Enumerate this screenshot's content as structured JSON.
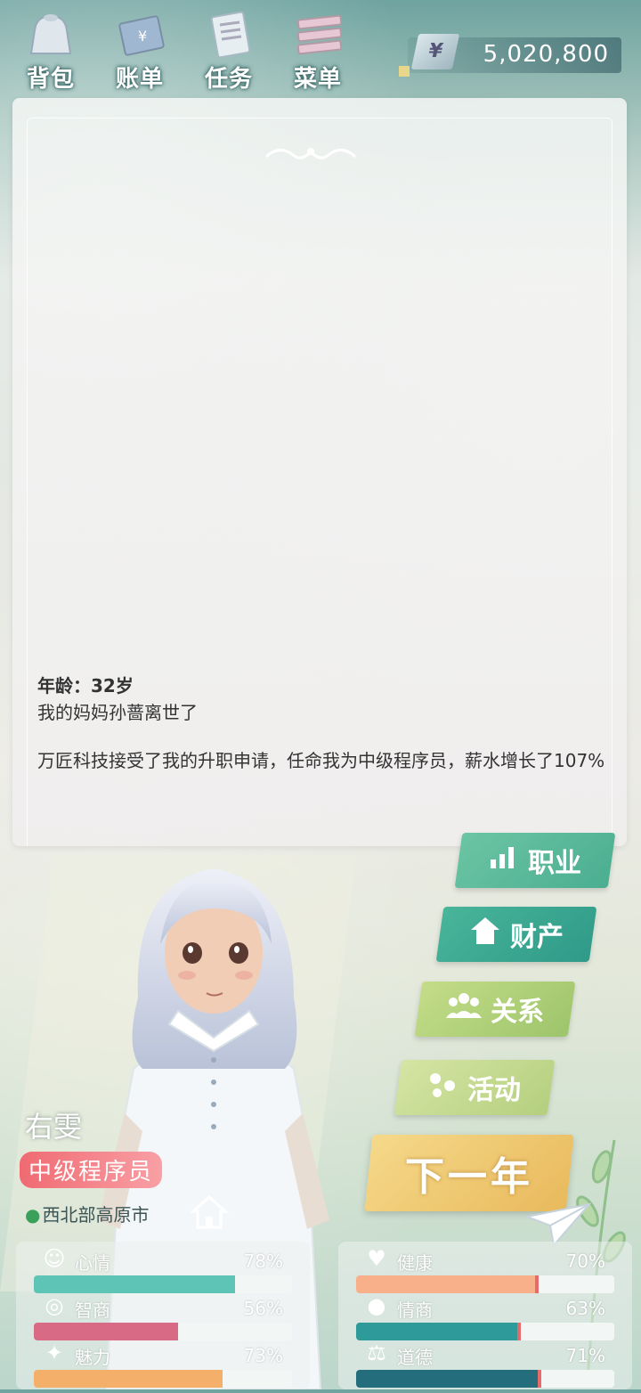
{
  "topbar": {
    "buttons": [
      {
        "label": "背包",
        "icon": "bag-icon"
      },
      {
        "label": "账单",
        "icon": "bill-icon"
      },
      {
        "label": "任务",
        "icon": "task-icon"
      },
      {
        "label": "菜单",
        "icon": "menu-icon"
      }
    ],
    "money": {
      "currency": "¥",
      "value": "5,020,800"
    }
  },
  "story": {
    "age_line": "年龄：32岁",
    "event1": "我的妈妈孙蔷离世了",
    "event2": "万匠科技接受了我的升职申请，任命我为中级程序员，薪水增长了107%"
  },
  "character": {
    "name": "右雯",
    "job": "中级程序员",
    "city": "西北部高原市"
  },
  "actions": {
    "career": "职业",
    "property": "财产",
    "relationship": "关系",
    "activity": "活动",
    "next_year": "下一年"
  },
  "stats": {
    "left": [
      {
        "name": "心情",
        "pct": "78%",
        "value": 78,
        "color": "#5ec4b6",
        "icon": "smile-icon"
      },
      {
        "name": "智商",
        "pct": "56%",
        "value": 56,
        "color": "#d86a86",
        "icon": "bulb-icon"
      },
      {
        "name": "魅力",
        "pct": "73%",
        "value": 73,
        "color": "#f4b06b",
        "icon": "sparkle-icon"
      }
    ],
    "right": [
      {
        "name": "健康",
        "pct": "70%",
        "value": 70,
        "color": "#f7b08a",
        "icon": "heart-icon"
      },
      {
        "name": "情商",
        "pct": "63%",
        "value": 63,
        "color": "#2e9a9a",
        "icon": "apple-icon"
      },
      {
        "name": "道德",
        "pct": "71%",
        "value": 71,
        "color": "#236d7d",
        "icon": "scale-icon"
      }
    ]
  },
  "colors": {
    "accent": "#49b59a",
    "job_badge": "#f06a72",
    "next_button": "#e9b95c"
  }
}
